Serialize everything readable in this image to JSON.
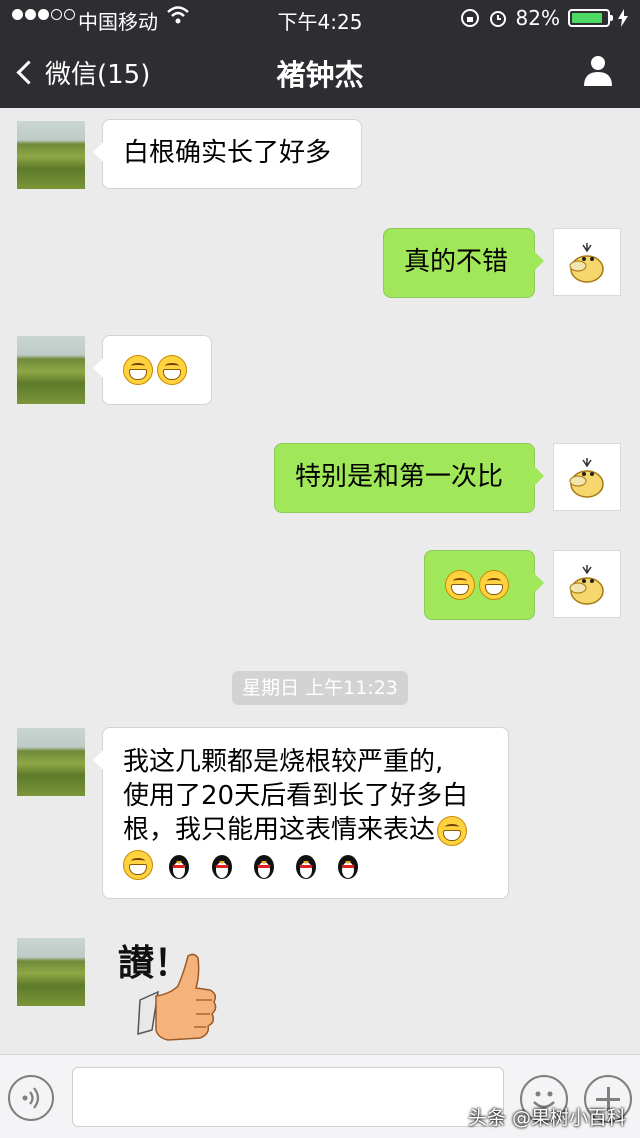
{
  "status_bar": {
    "carrier": "中国移动",
    "time": "下午4:25",
    "battery": "82%"
  },
  "nav": {
    "back_label": "微信(15)",
    "title": "褚钟杰"
  },
  "messages": [
    {
      "side": "in",
      "text": "白根确实长了好多"
    },
    {
      "side": "out",
      "text": "真的不错"
    },
    {
      "side": "in",
      "emoji": [
        "grin-emoji",
        "grin-emoji"
      ]
    },
    {
      "side": "out",
      "text": "特别是和第一次比"
    },
    {
      "side": "out",
      "emoji": [
        "grin-emoji",
        "grin-emoji"
      ]
    },
    {
      "side": "in",
      "lines": [
        "我这几颗都是烧根较严重的,",
        "使用了20天后看到长了好多白",
        "根，我只能用这表情来表达"
      ]
    },
    {
      "side": "in",
      "sticker_text": "讃！"
    }
  ],
  "timestamp": "星期日 上午11:23",
  "watermark": "头条 @果树小百科",
  "icons": {
    "back": "chevron-left-icon",
    "profile": "person-icon",
    "voice": "voice-icon",
    "emoji": "smiley-icon",
    "more": "plus-icon"
  }
}
